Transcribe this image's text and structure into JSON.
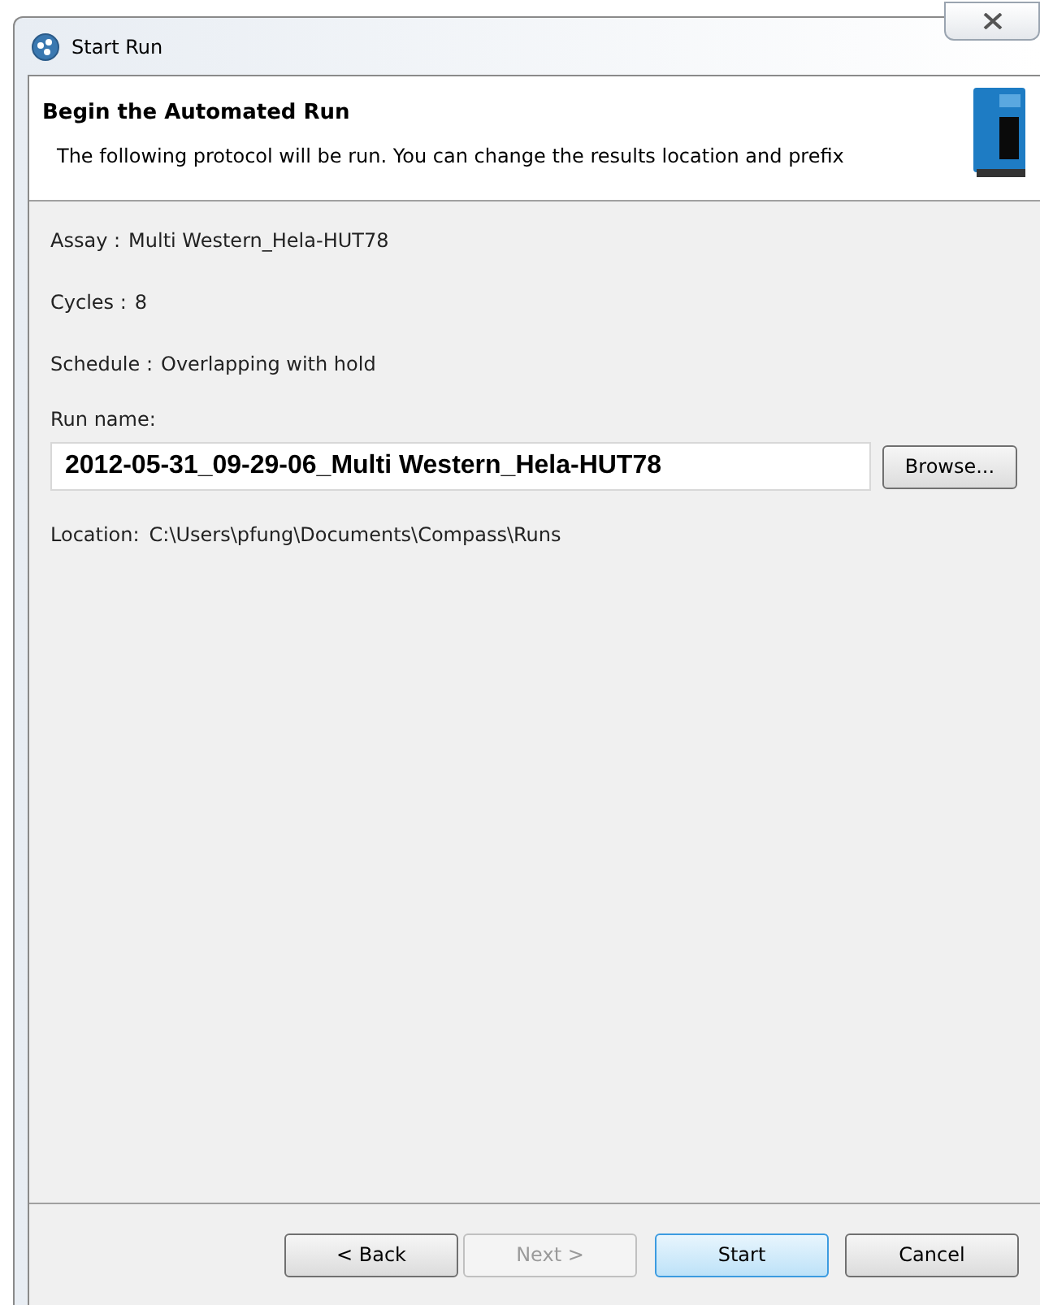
{
  "window": {
    "title": "Start Run"
  },
  "header": {
    "title": "Begin the Automated Run",
    "description": "The following protocol will be run. You can change the results location and prefix"
  },
  "info": [
    {
      "label": "Assay :",
      "value": "Multi Western_Hela-HUT78"
    },
    {
      "label": "Cycles :",
      "value": "8"
    },
    {
      "label": "Schedule :",
      "value": "Overlapping with hold"
    }
  ],
  "run_name": {
    "label": "Run name:",
    "value": "2012-05-31_09-29-06_Multi Western_Hela-HUT78",
    "browse_button": "Browse..."
  },
  "location": {
    "label": "Location:",
    "value": "C:\\Users\\pfung\\Documents\\Compass\\Runs"
  },
  "buttons": [
    {
      "label": "< Back",
      "disabled": false,
      "default": false
    },
    {
      "label": "Next >",
      "disabled": true,
      "default": false
    },
    {
      "label": "Start",
      "disabled": false,
      "default": true
    },
    {
      "label": "Cancel",
      "disabled": false,
      "default": false
    }
  ]
}
